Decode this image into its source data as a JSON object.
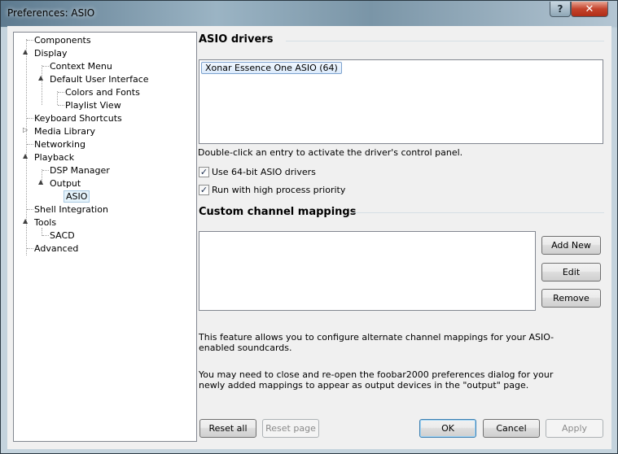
{
  "window": {
    "title": "Preferences: ASIO",
    "help_label": "?",
    "close_label": "✕"
  },
  "tree": {
    "items": [
      {
        "label": "Components"
      },
      {
        "label": "Display"
      },
      {
        "label": "Context Menu"
      },
      {
        "label": "Default User Interface"
      },
      {
        "label": "Colors and Fonts"
      },
      {
        "label": "Playlist View"
      },
      {
        "label": "Keyboard Shortcuts"
      },
      {
        "label": "Media Library"
      },
      {
        "label": "Networking"
      },
      {
        "label": "Playback"
      },
      {
        "label": "DSP Manager"
      },
      {
        "label": "Output"
      },
      {
        "label": "ASIO"
      },
      {
        "label": "Shell Integration"
      },
      {
        "label": "Tools"
      },
      {
        "label": "SACD"
      },
      {
        "label": "Advanced"
      }
    ],
    "selected": "ASIO"
  },
  "asio": {
    "heading": "ASIO drivers",
    "drivers": [
      "Xonar Essence One ASIO (64)"
    ],
    "hint": "Double-click an entry to activate the driver's control panel.",
    "use64_label": "Use 64-bit ASIO drivers",
    "use64_checked": true,
    "highprio_label": "Run with high process priority",
    "highprio_checked": true
  },
  "mappings": {
    "heading": "Custom channel mappings",
    "add_label": "Add New",
    "edit_label": "Edit",
    "remove_label": "Remove",
    "info1": "This feature allows you to configure alternate channel mappings for your ASIO-enabled soundcards.",
    "info2": "You may need to close and re-open the foobar2000 preferences dialog for your newly added mappings to appear as output devices in the \"output\" page."
  },
  "footer": {
    "reset_all": "Reset all",
    "reset_page": "Reset page",
    "ok": "OK",
    "cancel": "Cancel",
    "apply": "Apply"
  },
  "icons": {
    "expanded": "▲",
    "collapsed": "▷",
    "check": "✓"
  }
}
